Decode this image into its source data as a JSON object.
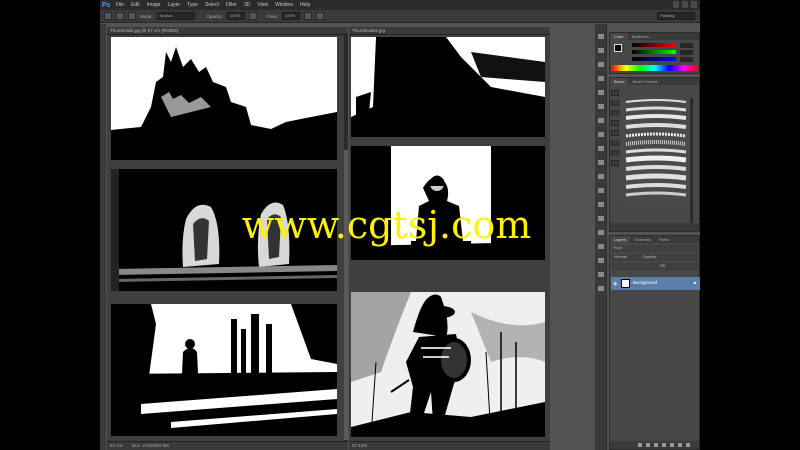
{
  "app": {
    "logo": "Ps",
    "menu": [
      "File",
      "Edit",
      "Image",
      "Layer",
      "Type",
      "Select",
      "Filter",
      "3D",
      "View",
      "Window",
      "Help"
    ],
    "workspace": "Painting"
  },
  "options": {
    "mode_label": "Mode:",
    "mode_value": "Normal",
    "opacity_label": "Opacity:",
    "opacity_value": "100%",
    "flow_label": "Flow:",
    "flow_value": "100%"
  },
  "documents": {
    "left": {
      "tab_title": "Thumbnails.jpg @ 57.1% (RGB/8)",
      "zoom": "57.1%",
      "doc_size": "Doc: 2.91M/62.9M"
    },
    "right": {
      "tab_title": "Thumbnails2.jpg",
      "zoom": "57.14%"
    }
  },
  "panels": {
    "color_tabs": [
      "Color",
      "Swatches"
    ],
    "brush_tabs": [
      "Brush",
      "Brush Presets"
    ],
    "layer_tabs": [
      "Layers",
      "Channels",
      "Paths"
    ],
    "kind_label": "Kind",
    "blend_mode": "Normal",
    "opacity_label": "Opacity:",
    "fill_label": "Fill:",
    "layers": [
      {
        "name": "Background",
        "locked": true
      }
    ]
  },
  "watermark": "www.cgtsj.com",
  "colors": {
    "ui_dark": "#3a3a3a",
    "ui_mid": "#535353",
    "layer_selected": "#5a7ea8",
    "watermark": "#fff200"
  }
}
